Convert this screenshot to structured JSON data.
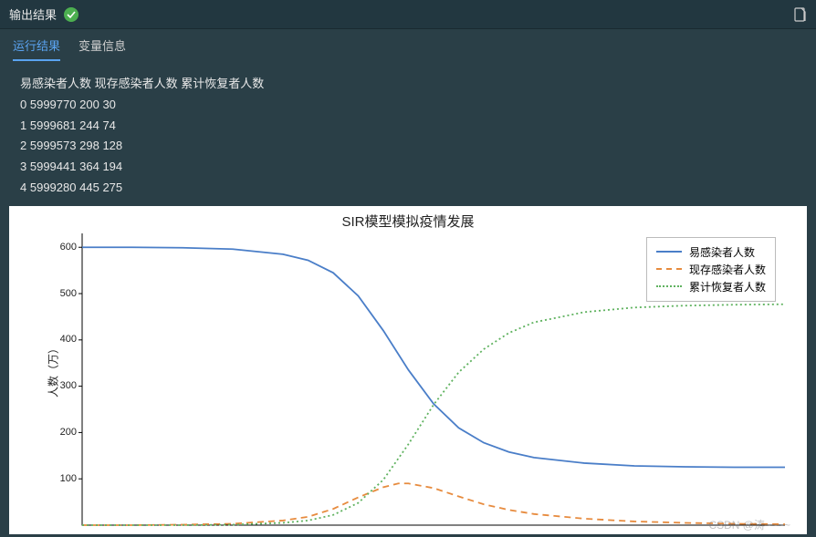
{
  "header": {
    "title": "输出结果",
    "status": "success"
  },
  "tabs": {
    "items": [
      {
        "label": "运行结果",
        "active": true
      },
      {
        "label": "变量信息",
        "active": false
      }
    ]
  },
  "output": {
    "header_line": "易感染者人数 现存感染者人数 累计恢复者人数",
    "rows": [
      {
        "idx": "0",
        "s": "5999770",
        "i": "200",
        "r": "30"
      },
      {
        "idx": "1",
        "s": "5999681",
        "i": "244",
        "r": "74"
      },
      {
        "idx": "2",
        "s": "5999573",
        "i": "298",
        "r": "128"
      },
      {
        "idx": "3",
        "s": "5999441",
        "i": "364",
        "r": "194"
      },
      {
        "idx": "4",
        "s": "5999280",
        "i": "445",
        "r": "275"
      }
    ]
  },
  "chart_data": {
    "type": "line",
    "title": "SIR模型模拟疫情发展",
    "ylabel": "人数（万）",
    "xlabel": "",
    "ylim": [
      0,
      630
    ],
    "xlim": [
      0,
      140
    ],
    "y_ticks": [
      100,
      200,
      300,
      400,
      500,
      600
    ],
    "series": [
      {
        "name": "易感染者人数",
        "color": "#4a7ec8",
        "style": "solid",
        "x": [
          0,
          10,
          20,
          30,
          40,
          45,
          50,
          55,
          60,
          65,
          70,
          75,
          80,
          85,
          90,
          100,
          110,
          120,
          130,
          140
        ],
        "values": [
          600,
          600,
          599,
          596,
          585,
          572,
          545,
          495,
          420,
          335,
          262,
          210,
          178,
          158,
          146,
          134,
          128,
          126,
          125,
          125
        ]
      },
      {
        "name": "现存感染者人数",
        "color": "#e78b3e",
        "style": "dashed",
        "x": [
          0,
          10,
          20,
          30,
          40,
          45,
          50,
          55,
          60,
          63,
          65,
          70,
          75,
          80,
          85,
          90,
          100,
          110,
          120,
          130,
          140
        ],
        "values": [
          0,
          0,
          1,
          3,
          10,
          18,
          35,
          60,
          82,
          90,
          90,
          80,
          62,
          45,
          33,
          24,
          14,
          8,
          5,
          3,
          2
        ]
      },
      {
        "name": "累计恢复者人数",
        "color": "#5fb25f",
        "style": "dotted",
        "x": [
          0,
          10,
          20,
          30,
          40,
          45,
          50,
          55,
          60,
          65,
          70,
          75,
          80,
          85,
          90,
          100,
          110,
          120,
          130,
          140
        ],
        "values": [
          0,
          0,
          0,
          1,
          5,
          10,
          22,
          48,
          98,
          175,
          260,
          330,
          380,
          415,
          438,
          460,
          470,
          474,
          476,
          477
        ]
      }
    ],
    "legend_position": "upper right"
  },
  "watermark": "CSDN @涛~~~~"
}
